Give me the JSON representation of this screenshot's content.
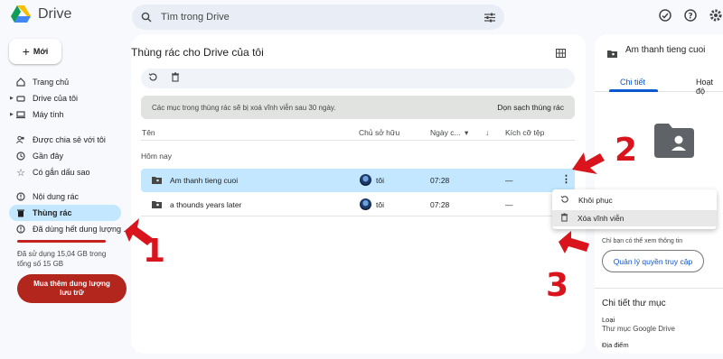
{
  "app": {
    "name": "Drive"
  },
  "search": {
    "placeholder": "Tìm trong Drive"
  },
  "sidebar": {
    "new_label": "Mới",
    "items": [
      {
        "label": "Trang chủ",
        "icon": "home-icon"
      },
      {
        "label": "Drive của tôi",
        "icon": "drive-icon"
      },
      {
        "label": "Máy tính",
        "icon": "computer-icon"
      },
      {
        "label": "Được chia sẻ với tôi",
        "icon": "shared-icon"
      },
      {
        "label": "Gần đây",
        "icon": "clock-icon"
      },
      {
        "label": "Có gắn dấu sao",
        "icon": "star-icon"
      },
      {
        "label": "Nội dung rác",
        "icon": "spam-icon"
      },
      {
        "label": "Thùng rác",
        "icon": "trash-icon"
      },
      {
        "label": "Đã dùng hết dung lượng ...",
        "icon": "alert-icon"
      }
    ],
    "storage_text": "Đã sử dụng 15,04 GB trong tổng số 15 GB",
    "storage_fraction": 1.0,
    "buy_label": "Mua thêm dung lượng lưu trữ"
  },
  "main": {
    "title": "Thùng rác cho Drive của tôi",
    "banner_text": "Các mục trong thùng rác sẽ bị xoá vĩnh viễn sau 30 ngày.",
    "banner_action": "Dọn sạch thùng rác",
    "columns": {
      "name": "Tên",
      "owner": "Chủ sở hữu",
      "date": "Ngày c...",
      "size": "Kích cỡ tệp"
    },
    "group_label": "Hôm nay",
    "rows": [
      {
        "name": "Am thanh tieng cuoi",
        "owner": "tôi",
        "date": "07:28",
        "size": "—",
        "selected": true
      },
      {
        "name": "a thounds years later",
        "owner": "tôi",
        "date": "07:28",
        "size": "—",
        "selected": false
      }
    ]
  },
  "context_menu": {
    "items": [
      {
        "label": "Khôi phục"
      },
      {
        "label": "Xóa vĩnh viễn"
      }
    ]
  },
  "details": {
    "title": "Am thanh tieng cuoi",
    "tabs": [
      "Chi tiết",
      "Hoạt độ"
    ],
    "access_note": "Chỉ bạn có thể xem thông tin",
    "manage_button": "Quản lý quyền truy cập",
    "section_title": "Chi tiết thư mục",
    "type_key": "Loại",
    "type_value": "Thư mục Google Drive",
    "location_key": "Địa điểm"
  },
  "annotations": [
    "1",
    "2",
    "3"
  ],
  "colors": {
    "accent": "#0b57d0",
    "selected": "#c2e7ff",
    "danger": "#b3261e",
    "annotation": "#d9141c"
  }
}
